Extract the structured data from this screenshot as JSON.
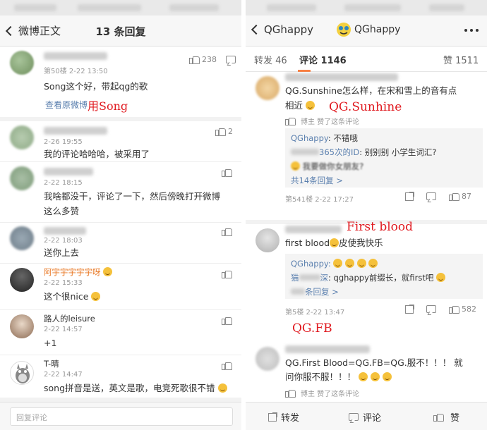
{
  "left": {
    "back_label": "微博正文",
    "title": "13 条回复",
    "top_comment": {
      "meta": "第50楼 2-22 13:50",
      "text": "Song这个好，带起qg的歌",
      "link": "查看原微博",
      "likes": "238",
      "annotation": "用Song"
    },
    "replies": [
      {
        "meta": "2-26 19:55",
        "text": "我的评论哈哈哈，被采用了",
        "likes": "2"
      },
      {
        "meta": "2-22 18:15",
        "text_line1": "我啥都没干，评论了一下，然后傍晚打开微博",
        "text_line2": "这么多赞",
        "likes": ""
      },
      {
        "meta": "2-22 18:03",
        "text": "送你上去",
        "likes": ""
      },
      {
        "name": "阿宇宇宇宇宇呀",
        "meta": "2-22 15:33",
        "text": "这个很nice",
        "likes": ""
      },
      {
        "name": "路人的leisure",
        "meta": "2-22 14:57",
        "text": "+1",
        "likes": ""
      },
      {
        "name": "T-晴",
        "meta": "2-22 14:47",
        "text": "song拼音是送，英文是歌，电竞死歌很不错",
        "likes": ""
      }
    ],
    "input_placeholder": "回复评论"
  },
  "right": {
    "account": "QGhappy",
    "tabs": {
      "repost": "转发 46",
      "comment": "评论 1146",
      "like": "赞 1511"
    },
    "c1": {
      "text_line1": "QG.Sunshine怎么样，在宋和雪上的音有点",
      "text_line2": "相近",
      "meta": "博主 赞了这条评论",
      "annotation": "QG.Sunhine",
      "sub_author": "QGhappy",
      "sub_text1": ": 不错哦",
      "sub_author2": "365次的ID",
      "sub_text2": ": 别别别 小学生词汇?",
      "sub_text3": "我要做你女朋友?",
      "sub_more": "共14条回复 >",
      "floor": "第541楼 2-22 17:27",
      "likes": "87"
    },
    "c2": {
      "text": "first blood",
      "text2": "皮使我快乐",
      "annotation": "First blood",
      "sub_author": "QGhappy:",
      "sub_text": ": qghappy前缀长，就first吧",
      "sub_prefix": "猫",
      "sub_suffix": "深",
      "sub_more": "条回复 >",
      "floor": "第5楼 2-22 13:47",
      "likes": "582"
    },
    "c3": {
      "annotation": "QG.FB",
      "text_line1": "QG.First Blood=QG.FB=QG.服不！！！ 就",
      "text_line2": "问你服不服！！！",
      "meta": "博主 赞了这条评论"
    },
    "bottom": {
      "repost": "转发",
      "comment": "评论",
      "like": "赞"
    }
  }
}
